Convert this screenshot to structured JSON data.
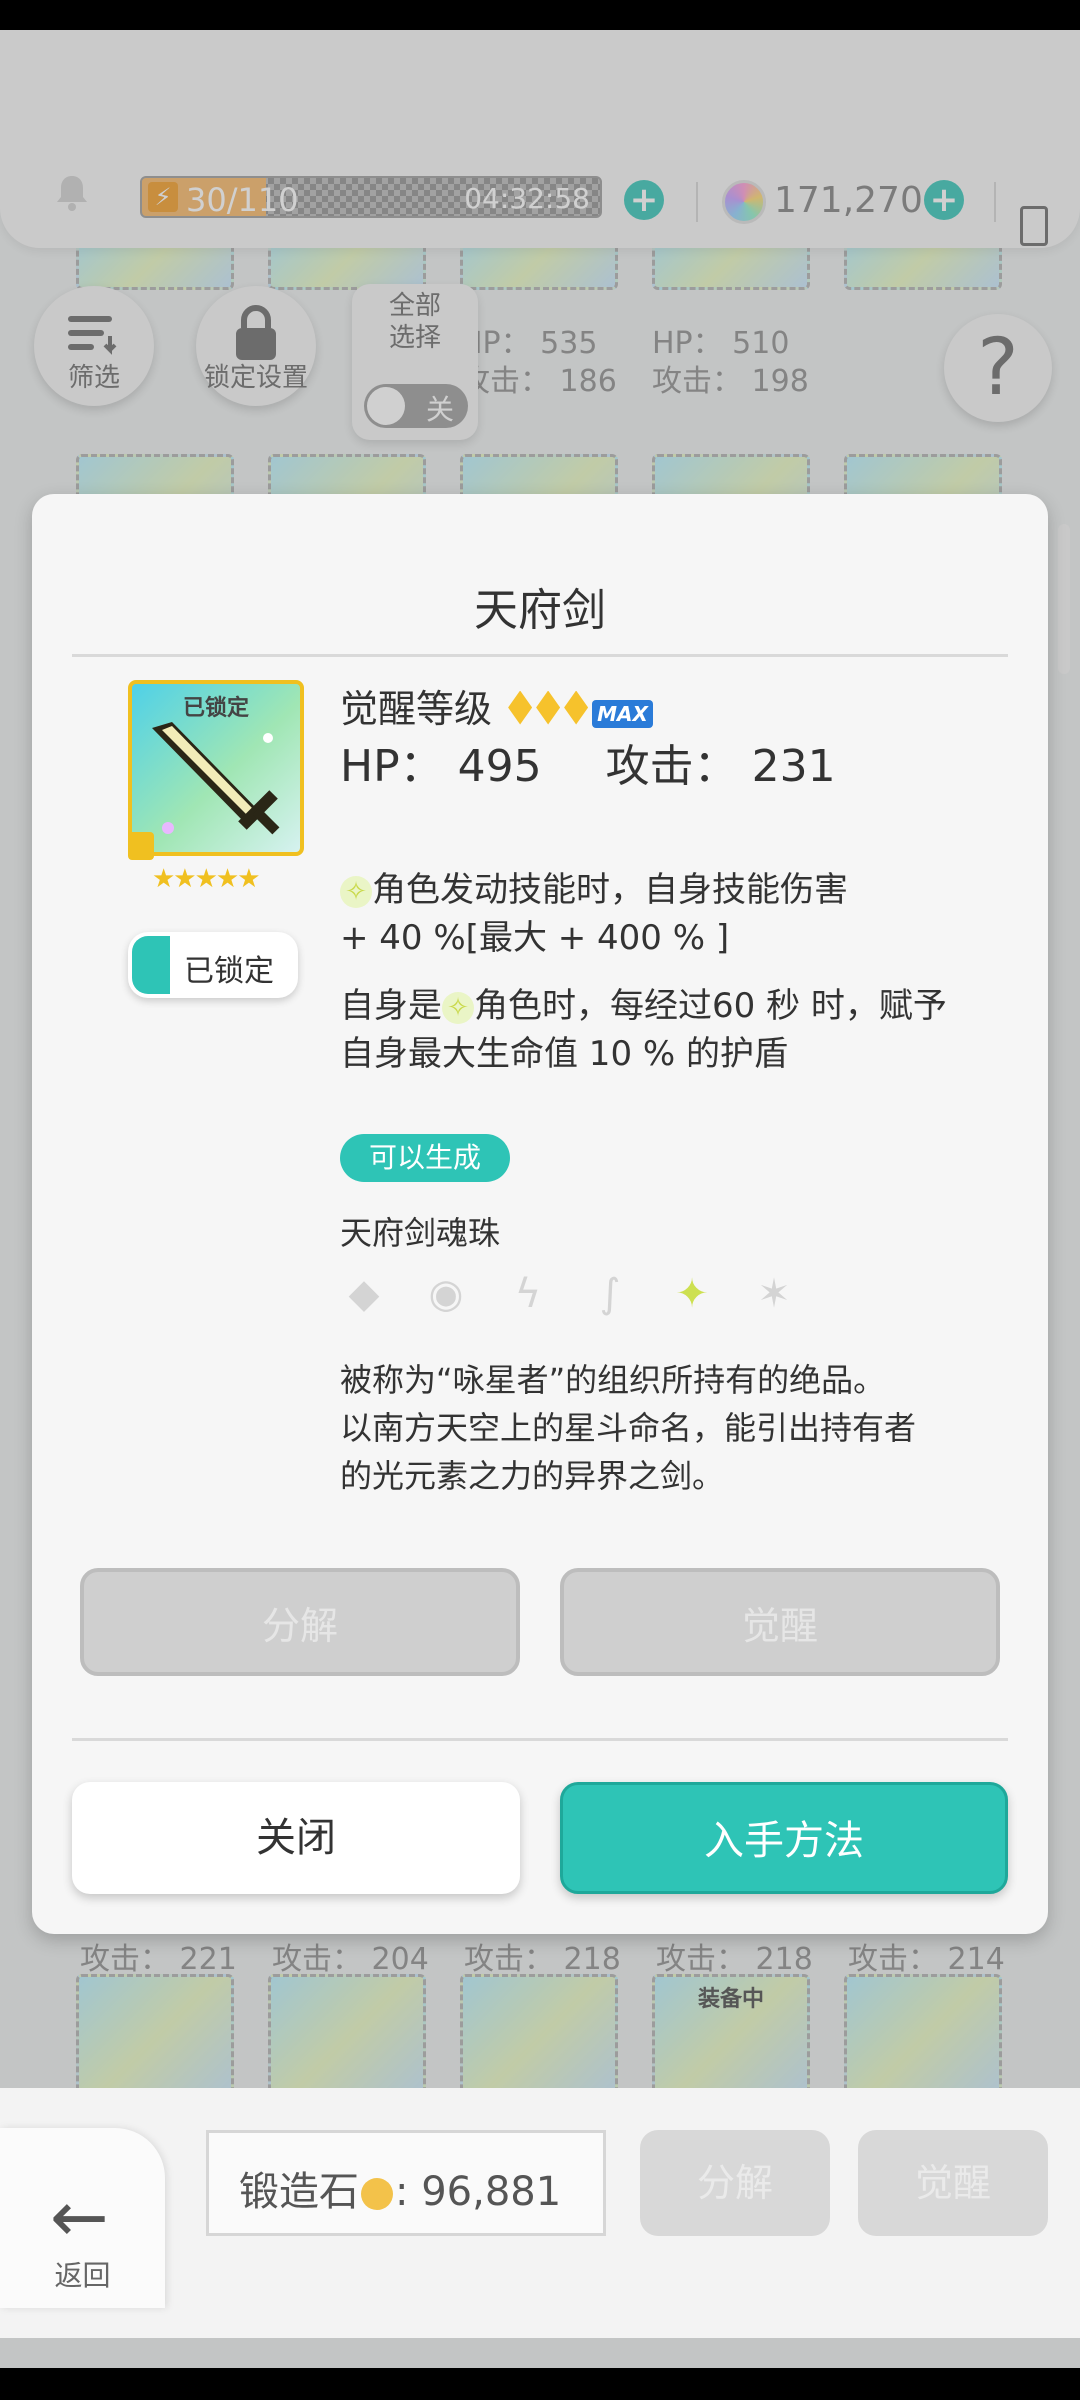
{
  "topbar": {
    "stamina": "30/110",
    "stamina_fraction": 0.27,
    "timer": "04:32:58",
    "gems": "171,270"
  },
  "toolbar": {
    "filter_label": "筛选",
    "lock_settings_label": "锁定设置",
    "select_all_label": "全部\n选择",
    "toggle_state": "关"
  },
  "background_stats": {
    "row1": [
      {
        "hp": "HP： 535",
        "atk": "攻击： 186"
      },
      {
        "hp": "HP： 510",
        "atk": "攻击： 198"
      }
    ],
    "row2_atk": [
      "攻击： 221",
      "攻击： 204",
      "攻击： 218",
      "攻击： 218",
      "攻击： 214"
    ],
    "equipped_tag": "装备中"
  },
  "dialog": {
    "title": "天府剑",
    "icon_tag": "已锁定",
    "lock_toggle_label": "已锁定",
    "awaken_label": "觉醒等级",
    "max_badge": "MAX",
    "hp_label": "HP： 495",
    "atk_label": "攻击： 231",
    "skill1_a": "角色发动技能时，自身技能伤害",
    "skill1_b": "+ 40 %[最大 + 400 % ]",
    "skill2_pre": "自身是",
    "skill2_post": "角色时，每经过60 秒 时，赋予",
    "skill2_b": "自身最大生命值 10 % 的护盾",
    "gen_badge": "可以生成",
    "soul_name": "天府剑魂珠",
    "flavor_1": "被称为“咏星者”的组织所持有的绝品。",
    "flavor_2": "以南方天空上的星斗命名，能引出持有者",
    "flavor_3": "的光元素之力的异界之剑。",
    "disassemble_label": "分解",
    "awaken_button_label": "觉醒",
    "close_label": "关闭",
    "acquire_label": "入手方法"
  },
  "bottom": {
    "back_label": "返回",
    "forge_label": "锻造石",
    "forge_value": "96,881",
    "disassemble_label": "分解",
    "awaken_label": "觉醒"
  },
  "colors": {
    "accent": "#2ec4b6",
    "gold": "#f0c020"
  }
}
